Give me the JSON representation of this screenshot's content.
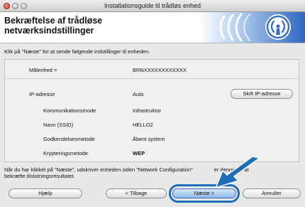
{
  "window": {
    "title": "Installationsguide til trådløs enhed"
  },
  "header": {
    "title_line1": "Bekræftelse af trådløse",
    "title_line2": "netværksindstillinger"
  },
  "instruction": "Klik på \"Næste\" for at sende følgende indstillinger til enheden.",
  "settings": {
    "target_label": "Målenhed =",
    "target_value": "BRNXXXXXXXXXXXX",
    "ip_label": "IP-adresse",
    "ip_value": "Auto",
    "change_ip_button": "Skift IP-adresse",
    "comm_mode_label": "Kommunikationsmode",
    "comm_mode_value": "Infrastruktur",
    "ssid_label": "Navn (SSID)",
    "ssid_value": "HELLO2",
    "auth_label": "Godkendelsesmetode",
    "auth_value": "Åbent system",
    "encryption_label": "Krypteringsmetode",
    "encryption_value": "WEP"
  },
  "note": {
    "part1": "Når du har klikket på \"Næste\", udskriver enheden siden \"Network Configuration\"",
    "part2": "er denne for at",
    "line2": "bekræfte tilslutningsresultatet."
  },
  "buttons": {
    "help": "Hjælp",
    "back": "< Tilbage",
    "next": "Næste >",
    "cancel": "Annuller"
  },
  "colors": {
    "accent": "#1f6fb8",
    "wifi_blue": "#3f74c8"
  },
  "icons": [
    "close-window-icon",
    "minimize-window-icon",
    "zoom-window-icon",
    "wireless-signal-icon",
    "pointer-arrow-icon"
  ]
}
